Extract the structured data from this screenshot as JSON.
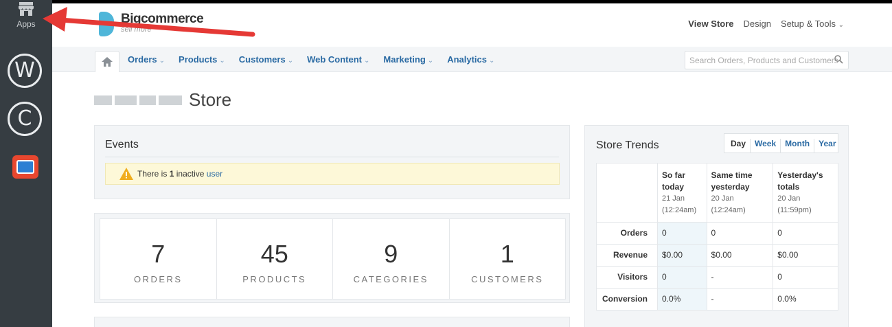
{
  "rail": {
    "apps_label": "Apps",
    "w_letter": "W",
    "c_letter": "C"
  },
  "header": {
    "logo_text": "Bigcommerce",
    "logo_tagline": "sell more",
    "links": {
      "view_store": "View Store",
      "design": "Design",
      "setup_tools": "Setup & Tools"
    }
  },
  "nav": {
    "items": [
      "Orders",
      "Products",
      "Customers",
      "Web Content",
      "Marketing",
      "Analytics"
    ],
    "search_placeholder": "Search Orders, Products and Customers"
  },
  "page": {
    "title_word": "Store"
  },
  "events": {
    "title": "Events",
    "alert_prefix": "There is",
    "alert_count": "1",
    "alert_mid": "inactive",
    "alert_link": "user"
  },
  "stats": [
    {
      "value": "7",
      "label": "ORDERS"
    },
    {
      "value": "45",
      "label": "PRODUCTS"
    },
    {
      "value": "9",
      "label": "CATEGORIES"
    },
    {
      "value": "1",
      "label": "CUSTOMERS"
    }
  ],
  "trends": {
    "title": "Store Trends",
    "periods": [
      "Day",
      "Week",
      "Month",
      "Year"
    ],
    "columns": [
      {
        "title": "So far today",
        "date": "21 Jan",
        "time": "(12:24am)"
      },
      {
        "title": "Same time yesterday",
        "date": "20 Jan",
        "time": "(12:24am)"
      },
      {
        "title": "Yesterday's totals",
        "date": "20 Jan",
        "time": "(11:59pm)"
      }
    ],
    "rows": [
      {
        "label": "Orders",
        "values": [
          "0",
          "0",
          "0"
        ]
      },
      {
        "label": "Revenue",
        "values": [
          "$0.00",
          "$0.00",
          "$0.00"
        ]
      },
      {
        "label": "Visitors",
        "values": [
          "0",
          "-",
          "0"
        ]
      },
      {
        "label": "Conversion",
        "values": [
          "0.0%",
          "-",
          "0.0%"
        ]
      }
    ]
  },
  "colors": {
    "rail_bg": "#363d42",
    "link_blue": "#2a6aa3",
    "alert_bg": "#fdf8d8",
    "arrow_red": "#e53935",
    "brand_blue": "#4fb6d9"
  }
}
